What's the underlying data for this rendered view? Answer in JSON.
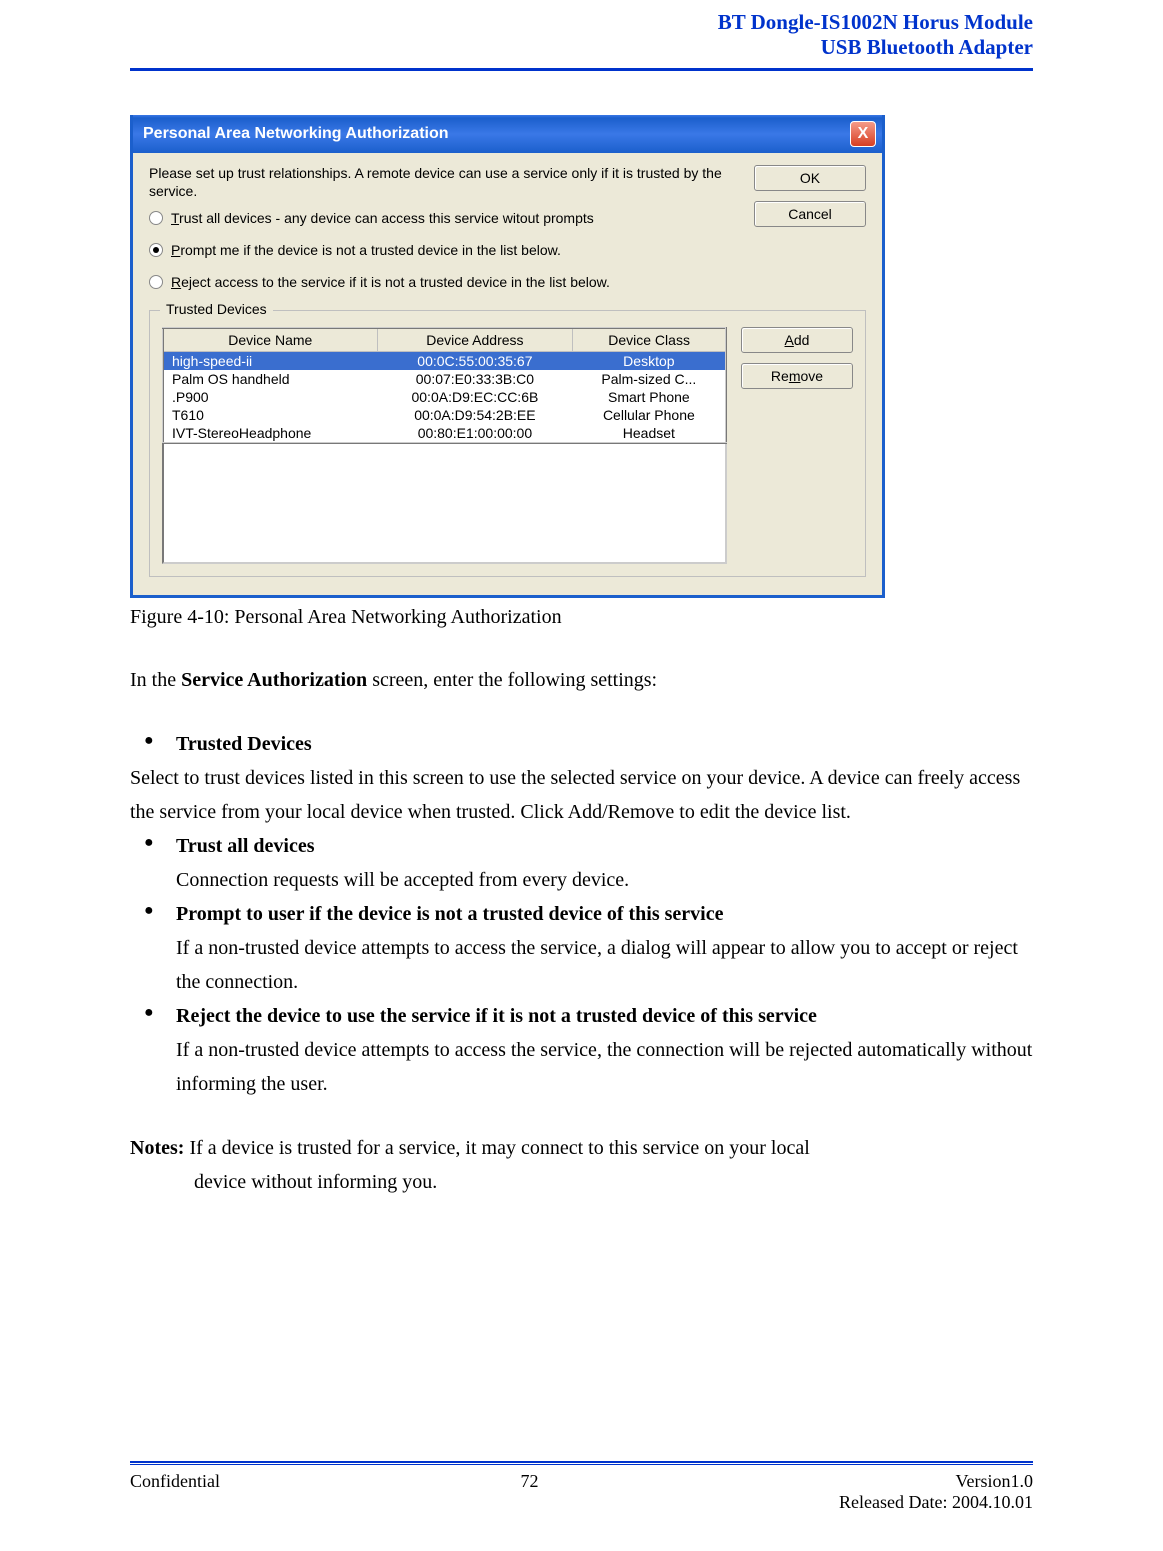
{
  "header": {
    "line1": "BT Dongle-IS1002N Horus Module",
    "line2": "USB Bluetooth Adapter"
  },
  "dialog": {
    "title": "Personal Area Networking Authorization",
    "close_glyph": "X",
    "intro": "Please set up trust relationships. A remote device can use a service only if it is trusted by the service.",
    "ok_label": "OK",
    "cancel_label": "Cancel",
    "radios": {
      "trust_all": "Trust all devices - any device can access this service witout prompts",
      "prompt": "Prompt me if the device is not a trusted device in the list below.",
      "reject": "Reject access to the service if it is not a trusted device in the list below."
    },
    "group_title": "Trusted Devices",
    "columns": {
      "name": "Device Name",
      "addr": "Device Address",
      "cls": "Device Class"
    },
    "rows": [
      {
        "name": "high-speed-ii",
        "addr": "00:0C:55:00:35:67",
        "cls": "Desktop",
        "selected": true
      },
      {
        "name": "Palm OS handheld",
        "addr": "00:07:E0:33:3B:C0",
        "cls": "Palm-sized C...",
        "selected": false
      },
      {
        "name": ".P900",
        "addr": "00:0A:D9:EC:CC:6B",
        "cls": "Smart Phone",
        "selected": false
      },
      {
        "name": "T610",
        "addr": "00:0A:D9:54:2B:EE",
        "cls": "Cellular Phone",
        "selected": false
      },
      {
        "name": "IVT-StereoHeadphone",
        "addr": "00:80:E1:00:00:00",
        "cls": "Headset",
        "selected": false
      }
    ],
    "add_label": "Add",
    "remove_label": "Remove"
  },
  "doc": {
    "figure_caption": "Figure 4-10: Personal Area Networking Authorization",
    "intro_prefix": "In the ",
    "intro_bold": "Service Authorization",
    "intro_suffix": " screen, enter the following settings:",
    "item1_head": "Trusted Devices",
    "item1_body": "Select to trust devices listed in this screen to use the selected service on your device. A device can freely access the service from your local device when trusted. Click Add/Remove to edit the device list.",
    "item2_head": "Trust all devices",
    "item2_body": "Connection requests will be accepted from every device.",
    "item3_head": "Prompt to user if the device is not a trusted device of this service",
    "item3_body": "If a non-trusted device attempts to access the service, a dialog will appear to allow you to accept or reject the connection.",
    "item4_head": "Reject the device to use the service if it is not a trusted device of this service",
    "item4_body": "If a non-trusted device attempts to access the service, the connection will be rejected automatically without informing the user.",
    "notes_label": "Notes:",
    "notes_body_1": " If a device is trusted for a service, it may connect to this service on your local",
    "notes_body_2": "device without informing you."
  },
  "footer": {
    "confidential": "Confidential",
    "page": "72",
    "version": "Version1.0",
    "released": "Released Date: 2004.10.01"
  }
}
